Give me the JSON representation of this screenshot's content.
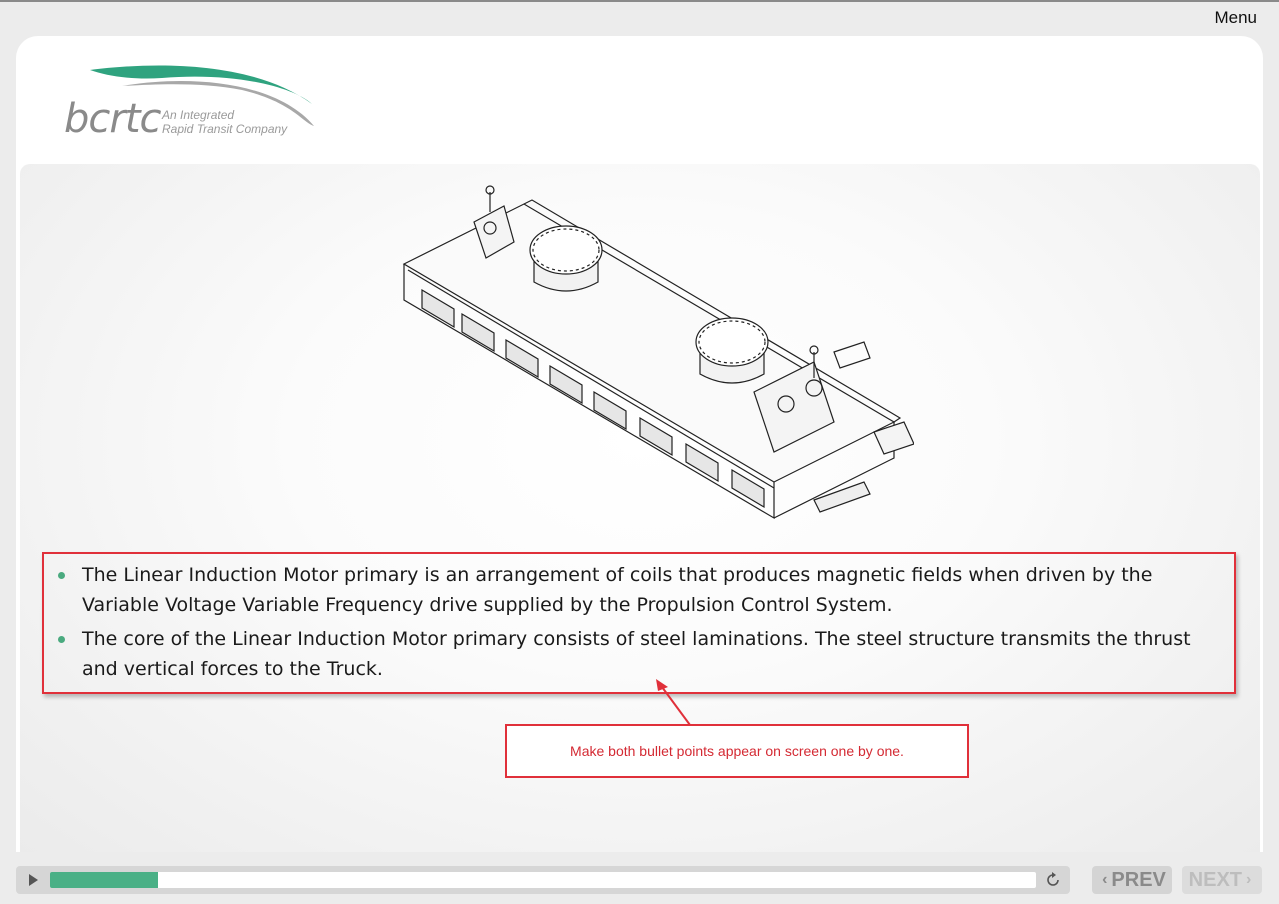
{
  "header": {
    "menu_label": "Menu"
  },
  "logo": {
    "name": "bcrtc",
    "tagline_line1": "An Integrated",
    "tagline_line2": "Rapid Transit Company",
    "colors": {
      "swoosh_green": "#2fa37f",
      "swoosh_gray": "#a8a8a8",
      "text": "#8a8a8a"
    }
  },
  "slide": {
    "illustration_icon": "linear-induction-motor-drawing",
    "bullets": [
      "The Linear Induction Motor primary is an arrangement of coils that produces magnetic fields when driven by the Variable Voltage Variable Frequency drive supplied by the Propulsion Control System.",
      "The core of the Linear Induction Motor primary consists of steel laminations. The steel structure transmits the thrust and vertical forces to the Truck."
    ],
    "review_note": "Make both bullet points appear on screen one by one.",
    "colors": {
      "bullet": "#4aaa7f",
      "annotation": "#e0303a"
    }
  },
  "player": {
    "progress_fraction": 0.11,
    "prev_label": "PREV",
    "next_label": "NEXT",
    "colors": {
      "progress": "#4ab086"
    }
  }
}
